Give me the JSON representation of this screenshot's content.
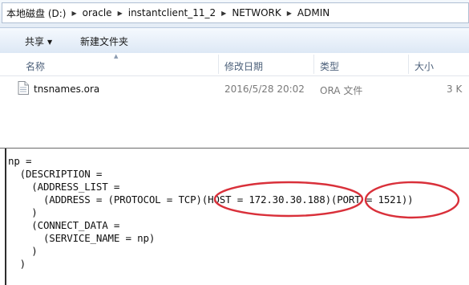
{
  "explorer": {
    "breadcrumb": [
      "本地磁盘 (D:)",
      "oracle",
      "instantclient_11_2",
      "NETWORK",
      "ADMIN"
    ],
    "toolbar": {
      "share_label": "共享",
      "new_folder_label": "新建文件夹"
    },
    "columns": {
      "name": "名称",
      "date": "修改日期",
      "type": "类型",
      "size": "大小"
    },
    "files": [
      {
        "name": "tnsnames.ora",
        "date": "2016/5/28 20:02",
        "type": "ORA 文件",
        "size": "3 K"
      }
    ]
  },
  "code": {
    "lines": [
      "np =",
      "  (DESCRIPTION =",
      "    (ADDRESS_LIST =",
      "      (ADDRESS = (PROTOCOL = TCP)(HOST = 172.30.30.188)(PORT = 1521))",
      "    )",
      "    (CONNECT_DATA =",
      "      (SERVICE_NAME = np)",
      "    )",
      "  )"
    ]
  },
  "colors": {
    "highlight": "#d9303a",
    "header_text": "#4c607a",
    "file_meta_text": "#7a7a7a"
  }
}
